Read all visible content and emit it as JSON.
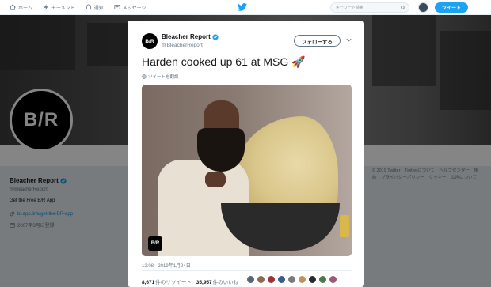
{
  "nav": {
    "home": "ホーム",
    "moments": "モーメント",
    "notifications": "通知",
    "messages": "メッセージ",
    "search_placeholder": "キーワード検索",
    "tweet_button": "ツイート"
  },
  "profile": {
    "avatar_text": "B/R",
    "name": "Bleacher Report",
    "handle": "@BleacherReport",
    "bio": "Get the Free B/R App",
    "link": "br.app.link/get-the-BR-app",
    "joined": "2007年3月に登録"
  },
  "footer": {
    "items": [
      "© 2019 Twitter",
      "Twitterについて",
      "ヘルプセンター",
      "規約",
      "プライバシーポリシー",
      "クッキー",
      "広告について"
    ]
  },
  "modal": {
    "avatar_text": "B/R",
    "name": "Bleacher Report",
    "handle": "@BleacherReport",
    "follow_button": "フォローする",
    "tweet_text": "Harden cooked up 61 at MSG 🚀",
    "translate": "ツイートを翻訳",
    "media_logo": "B/R",
    "timestamp": "12:08 - 2019年1月24日",
    "retweets_count": "8,671",
    "retweets_label": "件のリツイート",
    "likes_count": "35,957",
    "likes_label": "件のいいね"
  },
  "colors": {
    "accent": "#1da1f2",
    "verified": "#1da1f2"
  }
}
